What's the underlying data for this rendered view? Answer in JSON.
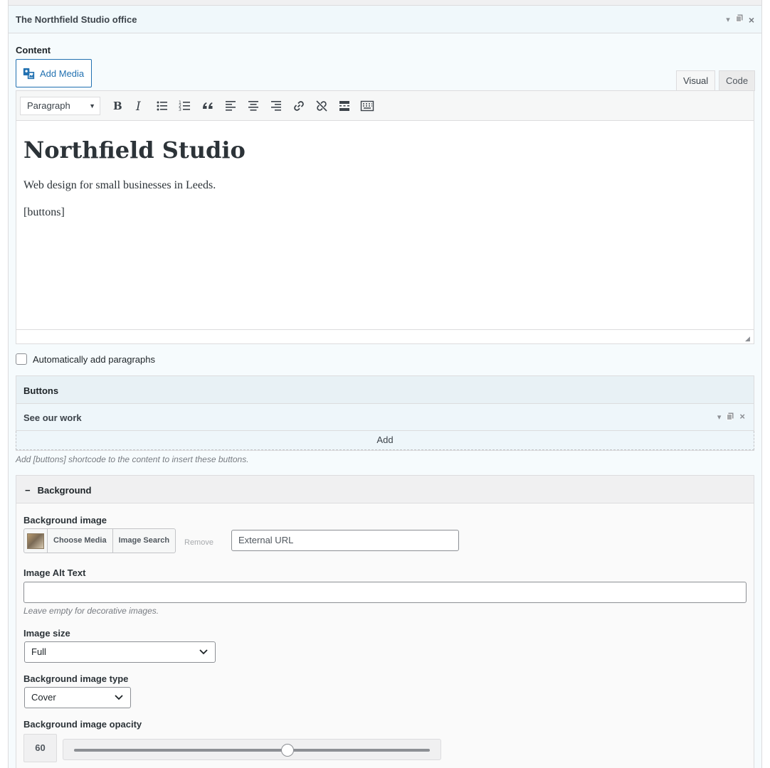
{
  "panel": {
    "title": "The Northfield Studio office"
  },
  "content": {
    "label": "Content",
    "add_media": "Add Media",
    "tabs": {
      "visual": "Visual",
      "code": "Code"
    },
    "format_select": "Paragraph",
    "toolbar_icons": [
      "bold-icon",
      "italic-icon",
      "bullet-list-icon",
      "numbered-list-icon",
      "blockquote-icon",
      "align-left-icon",
      "align-center-icon",
      "align-right-icon",
      "link-icon",
      "unlink-icon",
      "read-more-icon",
      "toolbar-toggle-icon"
    ],
    "heading": "Northfield Studio",
    "paragraph": "Web design for small businesses in Leeds.",
    "shortcode": "[buttons]"
  },
  "auto_paragraphs": {
    "label": "Automatically add paragraphs",
    "checked": false
  },
  "buttons": {
    "header": "Buttons",
    "items": [
      {
        "label": "See our work"
      }
    ],
    "add_label": "Add",
    "hint": "Add [buttons] shortcode to the content to insert these buttons."
  },
  "background": {
    "header": "Background",
    "collapse_symbol": "−",
    "image_label": "Background image",
    "choose_media": "Choose Media",
    "image_search": "Image Search",
    "remove": "Remove",
    "external_url_placeholder": "External URL",
    "alt_label": "Image Alt Text",
    "alt_value": "",
    "alt_hint": "Leave empty for decorative images.",
    "size_label": "Image size",
    "size_value": "Full",
    "type_label": "Background image type",
    "type_value": "Cover",
    "opacity_label": "Background image opacity",
    "opacity_value": "60",
    "opacity_fraction": 0.6
  },
  "colors": {
    "accent": "#2271b1",
    "panel_bg": "#f6fbfd",
    "border": "#dcdcde"
  }
}
